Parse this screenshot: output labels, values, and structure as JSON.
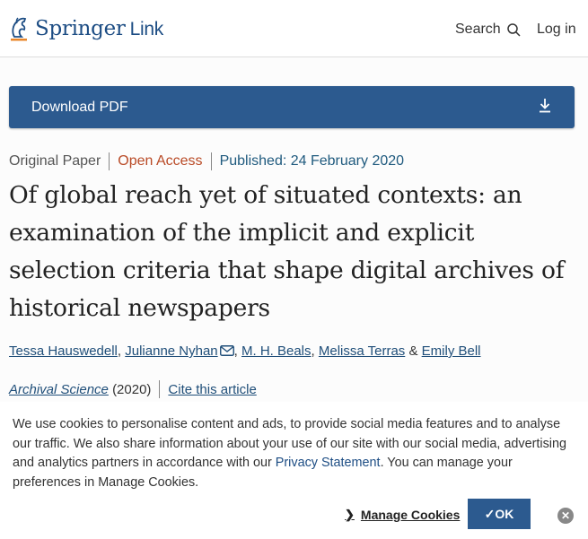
{
  "header": {
    "logo_text": "Springer",
    "logo_link": "Link",
    "search_label": "Search",
    "login_label": "Log in"
  },
  "download": {
    "label": "Download PDF"
  },
  "meta": {
    "type": "Original Paper",
    "access": "Open Access",
    "published": "Published: 24 February 2020"
  },
  "article": {
    "title": "Of global reach yet of situated contexts: an examination of the implicit and explicit selection criteria that shape digital archives of historical newspapers",
    "authors": [
      "Tessa Hauswedell",
      "Julianne Nyhan",
      "M. H. Beals",
      "Melissa Terras",
      "Emily Bell"
    ],
    "author_sep": ",",
    "author_and": "&",
    "journal": "Archival Science",
    "year": "(2020)",
    "cite": "Cite this article"
  },
  "cookie": {
    "text_before": "We use cookies to personalise content and ads, to provide social media features and to analyse our traffic. We also share information about your use of our site with our social media, advertising and analytics partners in accordance with our ",
    "privacy_link": "Privacy Statement",
    "text_after": ". You can manage your preferences in Manage Cookies.",
    "manage_label": "Manage Cookies",
    "ok_label": "✓OK",
    "close_glyph": "✕"
  },
  "colors": {
    "brand": "#1d4d84",
    "button": "#2c5a8f",
    "open_access": "#b94a26"
  }
}
